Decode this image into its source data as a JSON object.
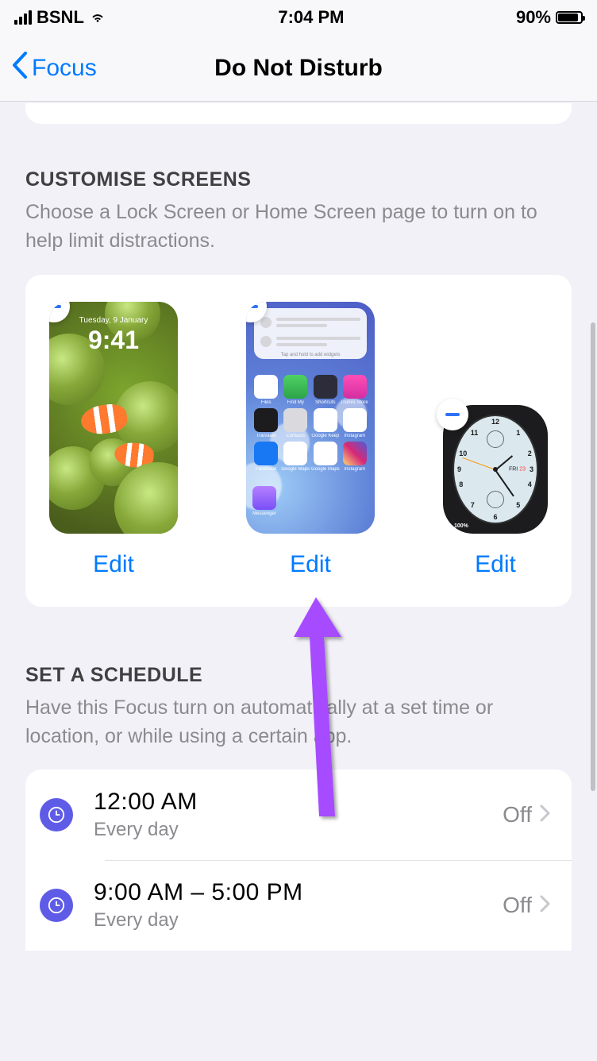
{
  "status": {
    "carrier": "BSNL",
    "time": "7:04 PM",
    "battery_pct": "90%"
  },
  "nav": {
    "back_label": "Focus",
    "title": "Do Not Disturb"
  },
  "customise": {
    "header": "Customise Screens",
    "description": "Choose a Lock Screen or Home Screen page to turn on to help limit distractions.",
    "edit_label": "Edit",
    "lock_screen": {
      "date": "Tuesday, 9 January",
      "time": "9:41"
    },
    "home_screen": {
      "hint": "Tap and hold to add widgets",
      "apps": [
        "Files",
        "Find My",
        "Shortcuts",
        "iTunes Store",
        "Translate",
        "Contacts",
        "Google Keep",
        "Instagram",
        "Facebook",
        "Google Maps",
        "Google Maps",
        "Instagram",
        "Messenger"
      ]
    },
    "watch": {
      "day_label": "FRI",
      "day_num": "23",
      "pct": "100%"
    }
  },
  "schedule": {
    "header": "Set a Schedule",
    "description": "Have this Focus turn on automatically at a set time or location, or while using a certain app.",
    "items": [
      {
        "time": "12:00 AM",
        "repeat": "Every day",
        "state": "Off"
      },
      {
        "time": "9:00 AM – 5:00 PM",
        "repeat": "Every day",
        "state": "Off"
      }
    ]
  },
  "colors": {
    "tint": "#007aff",
    "schedule_icon": "#5e5ce6"
  }
}
